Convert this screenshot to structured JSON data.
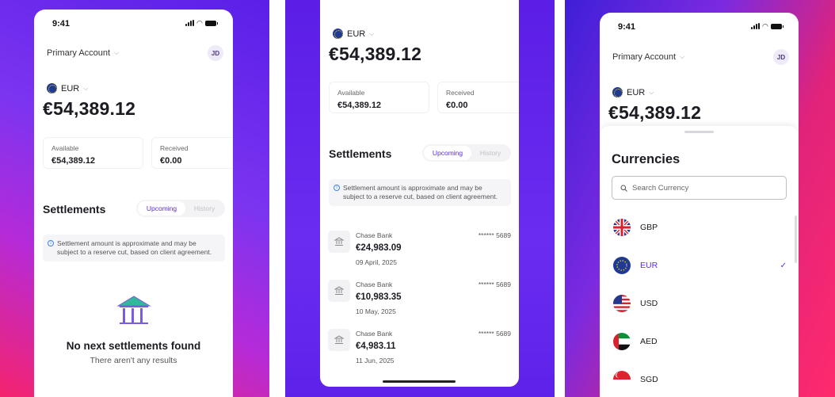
{
  "status": {
    "time": "9:41"
  },
  "account": {
    "label": "Primary Account",
    "avatar": "JD"
  },
  "currency": {
    "code": "EUR",
    "balance": "€54,389.12"
  },
  "cards": {
    "available_label": "Available",
    "available_value": "€54,389.12",
    "received_label": "Received",
    "received_value": "€0.00"
  },
  "settlements": {
    "title": "Settlements",
    "tab_upcoming": "Upcoming",
    "tab_history": "History",
    "notice": "Settlement amount is approximate and may be subject to a reserve cut, based on client agreement.",
    "empty_title": "No next settlements found",
    "empty_sub": "There aren't any results",
    "items": [
      {
        "bank": "Chase Bank",
        "account": "****** 5689",
        "amount": "€24,983.09",
        "date": "09 April, 2025"
      },
      {
        "bank": "Chase Bank",
        "account": "****** 5689",
        "amount": "€10,983.35",
        "date": "10 May, 2025"
      },
      {
        "bank": "Chase Bank",
        "account": "****** 5689",
        "amount": "€4,983.11",
        "date": "11 Jun, 2025"
      }
    ]
  },
  "currencies_sheet": {
    "title": "Currencies",
    "search_placeholder": "Search Currency",
    "items": [
      {
        "code": "GBP",
        "flag": "uk-flag"
      },
      {
        "code": "EUR",
        "flag": "eu-flag",
        "selected": true
      },
      {
        "code": "USD",
        "flag": "us-flag"
      },
      {
        "code": "AED",
        "flag": "uae-flag"
      },
      {
        "code": "SGD",
        "flag": "sg-flag"
      }
    ]
  },
  "colors": {
    "accent": "#5a2be0",
    "empty_icon": "#2fb89a"
  }
}
